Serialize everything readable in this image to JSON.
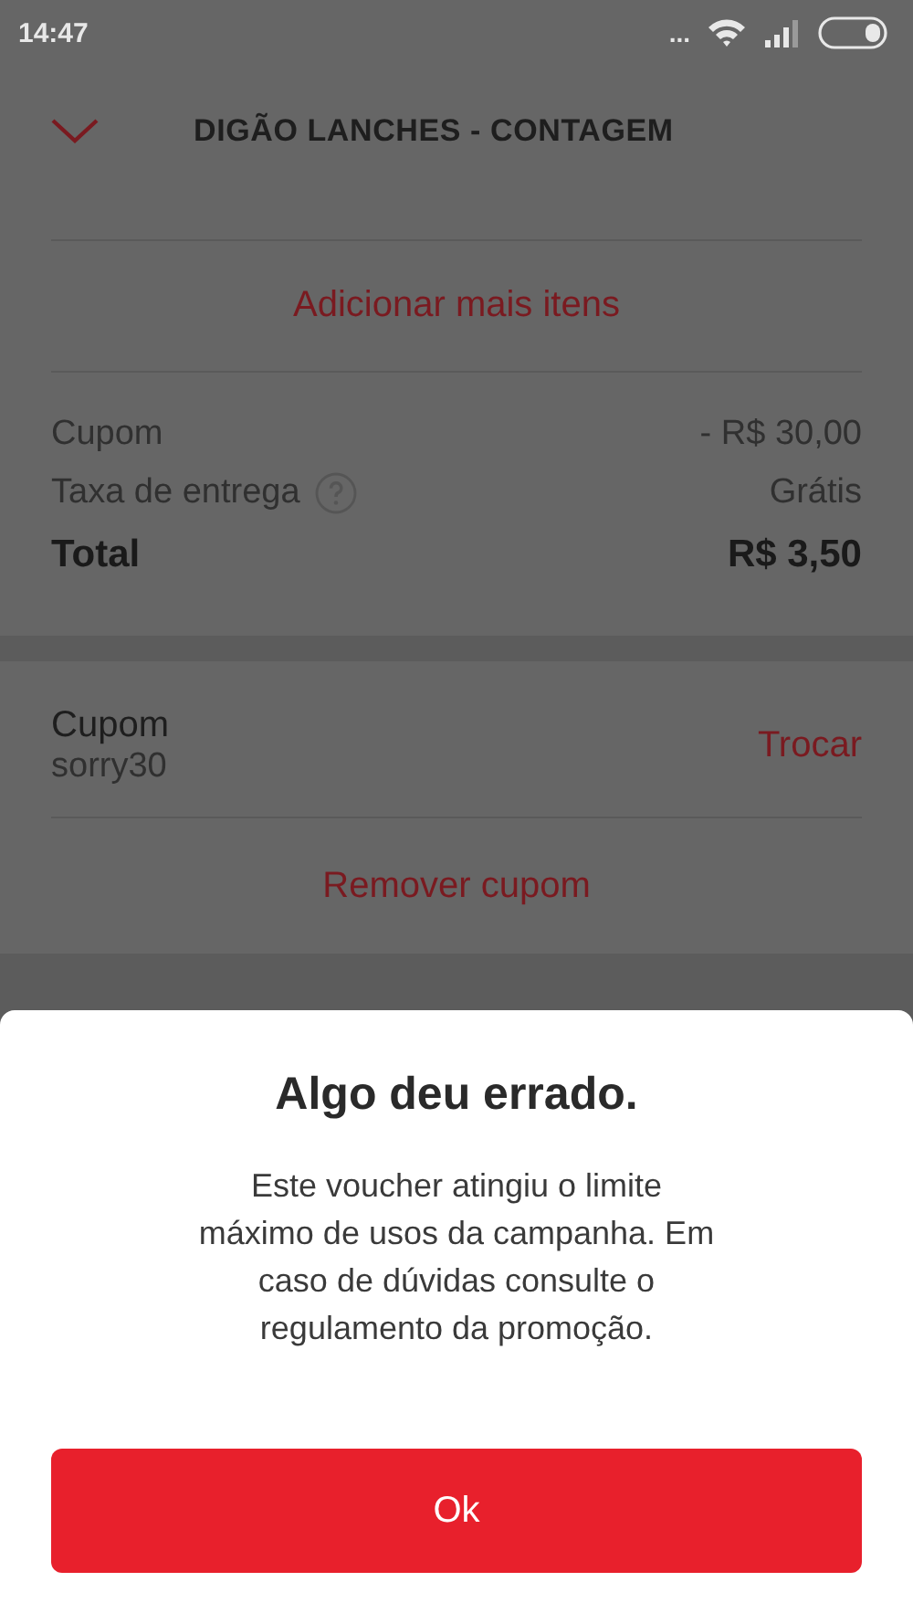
{
  "status_bar": {
    "time": "14:47",
    "dots": "..."
  },
  "header": {
    "title": "DIGÃO LANCHES - CONTAGEM"
  },
  "add_items": {
    "label": "Adicionar mais itens"
  },
  "summary": [
    {
      "kind": "muted",
      "label": "Cupom",
      "value": "- R$ 30,00",
      "help": false
    },
    {
      "kind": "muted",
      "label": "Taxa de entrega",
      "value": "Grátis",
      "help": true
    },
    {
      "kind": "total",
      "label": "Total",
      "value": "R$ 3,50",
      "help": false
    }
  ],
  "coupon": {
    "title": "Cupom",
    "code": "sorry30",
    "change": "Trocar",
    "remove": "Remover cupom"
  },
  "dialog": {
    "title": "Algo deu errado.",
    "message": "Este voucher atingiu o limite máximo de usos da campanha. Em caso de dúvidas consulte o regulamento da promoção.",
    "button": "Ok"
  }
}
